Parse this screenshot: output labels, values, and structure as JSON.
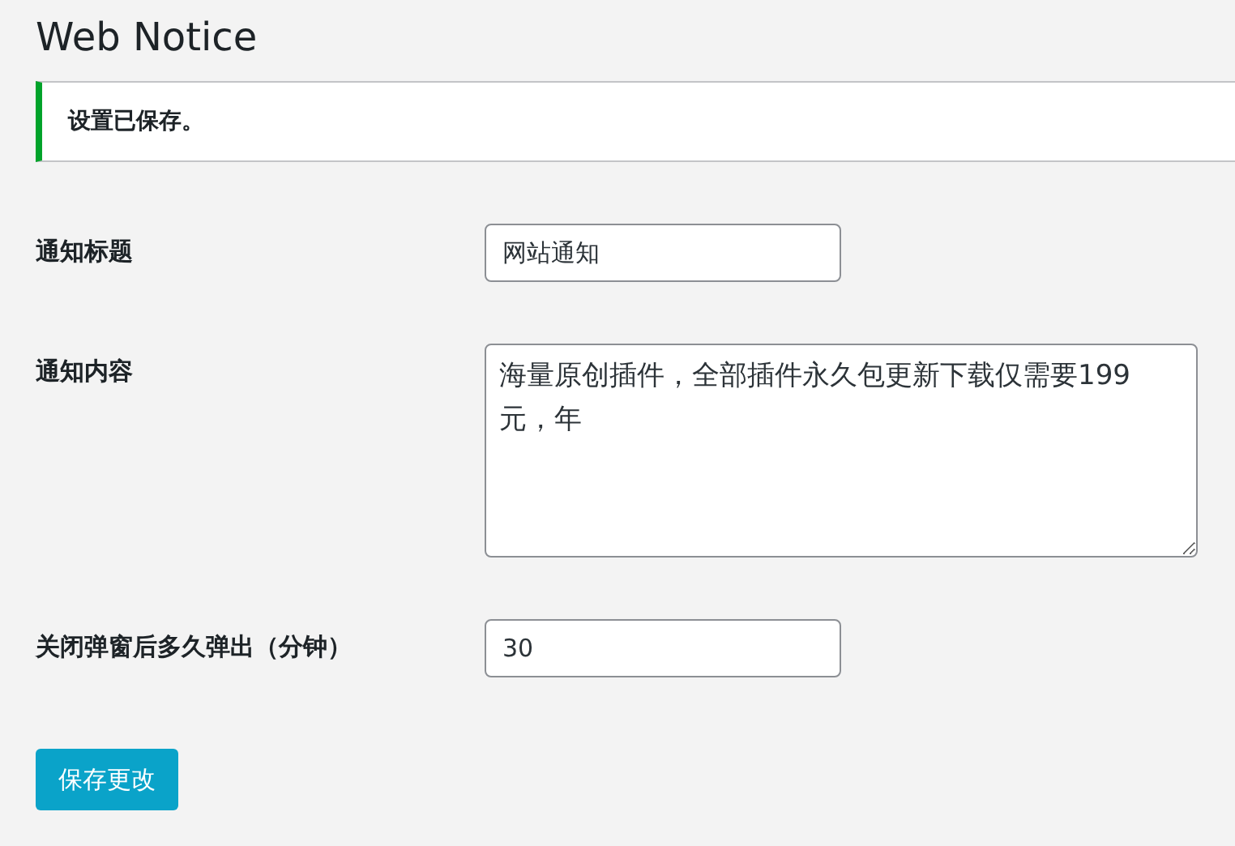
{
  "page": {
    "title": "Web Notice"
  },
  "notice": {
    "message": "设置已保存。",
    "success": true
  },
  "fields": [
    {
      "kind": "text",
      "label": "通知标题",
      "value": "网站通知"
    },
    {
      "kind": "textarea",
      "label": "通知内容",
      "value": "海量原创插件，全部插件永久包更新下载仅需要199元，年"
    },
    {
      "kind": "text",
      "label": "关闭弹窗后多久弹出（分钟）",
      "value": "30"
    }
  ],
  "buttons": [
    {
      "label": "保存更改"
    }
  ]
}
